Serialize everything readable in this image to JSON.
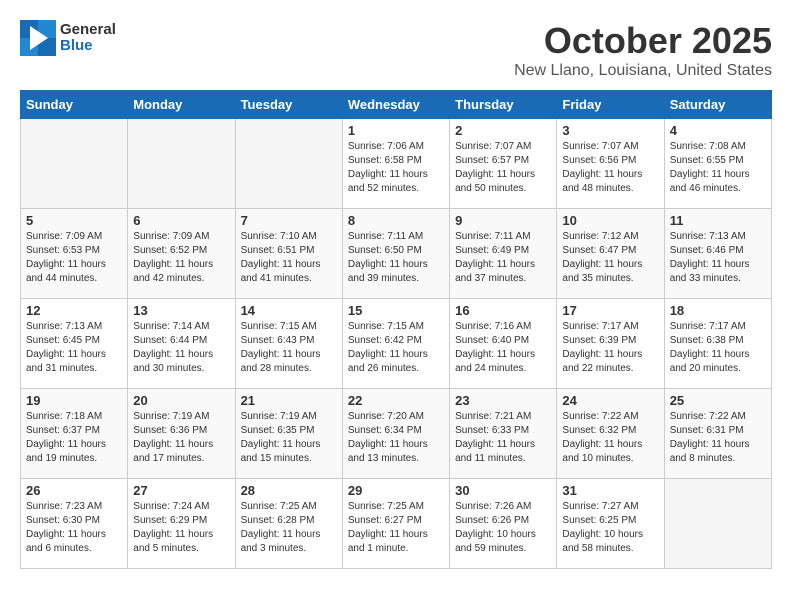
{
  "header": {
    "logo_general": "General",
    "logo_blue": "Blue",
    "month_title": "October 2025",
    "location": "New Llano, Louisiana, United States"
  },
  "weekdays": [
    "Sunday",
    "Monday",
    "Tuesday",
    "Wednesday",
    "Thursday",
    "Friday",
    "Saturday"
  ],
  "weeks": [
    [
      {
        "day": "",
        "empty": true
      },
      {
        "day": "",
        "empty": true
      },
      {
        "day": "",
        "empty": true
      },
      {
        "day": "1",
        "sunrise": "7:06 AM",
        "sunset": "6:58 PM",
        "daylight": "11 hours and 52 minutes."
      },
      {
        "day": "2",
        "sunrise": "7:07 AM",
        "sunset": "6:57 PM",
        "daylight": "11 hours and 50 minutes."
      },
      {
        "day": "3",
        "sunrise": "7:07 AM",
        "sunset": "6:56 PM",
        "daylight": "11 hours and 48 minutes."
      },
      {
        "day": "4",
        "sunrise": "7:08 AM",
        "sunset": "6:55 PM",
        "daylight": "11 hours and 46 minutes."
      }
    ],
    [
      {
        "day": "5",
        "sunrise": "7:09 AM",
        "sunset": "6:53 PM",
        "daylight": "11 hours and 44 minutes."
      },
      {
        "day": "6",
        "sunrise": "7:09 AM",
        "sunset": "6:52 PM",
        "daylight": "11 hours and 42 minutes."
      },
      {
        "day": "7",
        "sunrise": "7:10 AM",
        "sunset": "6:51 PM",
        "daylight": "11 hours and 41 minutes."
      },
      {
        "day": "8",
        "sunrise": "7:11 AM",
        "sunset": "6:50 PM",
        "daylight": "11 hours and 39 minutes."
      },
      {
        "day": "9",
        "sunrise": "7:11 AM",
        "sunset": "6:49 PM",
        "daylight": "11 hours and 37 minutes."
      },
      {
        "day": "10",
        "sunrise": "7:12 AM",
        "sunset": "6:47 PM",
        "daylight": "11 hours and 35 minutes."
      },
      {
        "day": "11",
        "sunrise": "7:13 AM",
        "sunset": "6:46 PM",
        "daylight": "11 hours and 33 minutes."
      }
    ],
    [
      {
        "day": "12",
        "sunrise": "7:13 AM",
        "sunset": "6:45 PM",
        "daylight": "11 hours and 31 minutes."
      },
      {
        "day": "13",
        "sunrise": "7:14 AM",
        "sunset": "6:44 PM",
        "daylight": "11 hours and 30 minutes."
      },
      {
        "day": "14",
        "sunrise": "7:15 AM",
        "sunset": "6:43 PM",
        "daylight": "11 hours and 28 minutes."
      },
      {
        "day": "15",
        "sunrise": "7:15 AM",
        "sunset": "6:42 PM",
        "daylight": "11 hours and 26 minutes."
      },
      {
        "day": "16",
        "sunrise": "7:16 AM",
        "sunset": "6:40 PM",
        "daylight": "11 hours and 24 minutes."
      },
      {
        "day": "17",
        "sunrise": "7:17 AM",
        "sunset": "6:39 PM",
        "daylight": "11 hours and 22 minutes."
      },
      {
        "day": "18",
        "sunrise": "7:17 AM",
        "sunset": "6:38 PM",
        "daylight": "11 hours and 20 minutes."
      }
    ],
    [
      {
        "day": "19",
        "sunrise": "7:18 AM",
        "sunset": "6:37 PM",
        "daylight": "11 hours and 19 minutes."
      },
      {
        "day": "20",
        "sunrise": "7:19 AM",
        "sunset": "6:36 PM",
        "daylight": "11 hours and 17 minutes."
      },
      {
        "day": "21",
        "sunrise": "7:19 AM",
        "sunset": "6:35 PM",
        "daylight": "11 hours and 15 minutes."
      },
      {
        "day": "22",
        "sunrise": "7:20 AM",
        "sunset": "6:34 PM",
        "daylight": "11 hours and 13 minutes."
      },
      {
        "day": "23",
        "sunrise": "7:21 AM",
        "sunset": "6:33 PM",
        "daylight": "11 hours and 11 minutes."
      },
      {
        "day": "24",
        "sunrise": "7:22 AM",
        "sunset": "6:32 PM",
        "daylight": "11 hours and 10 minutes."
      },
      {
        "day": "25",
        "sunrise": "7:22 AM",
        "sunset": "6:31 PM",
        "daylight": "11 hours and 8 minutes."
      }
    ],
    [
      {
        "day": "26",
        "sunrise": "7:23 AM",
        "sunset": "6:30 PM",
        "daylight": "11 hours and 6 minutes."
      },
      {
        "day": "27",
        "sunrise": "7:24 AM",
        "sunset": "6:29 PM",
        "daylight": "11 hours and 5 minutes."
      },
      {
        "day": "28",
        "sunrise": "7:25 AM",
        "sunset": "6:28 PM",
        "daylight": "11 hours and 3 minutes."
      },
      {
        "day": "29",
        "sunrise": "7:25 AM",
        "sunset": "6:27 PM",
        "daylight": "11 hours and 1 minute."
      },
      {
        "day": "30",
        "sunrise": "7:26 AM",
        "sunset": "6:26 PM",
        "daylight": "10 hours and 59 minutes."
      },
      {
        "day": "31",
        "sunrise": "7:27 AM",
        "sunset": "6:25 PM",
        "daylight": "10 hours and 58 minutes."
      },
      {
        "day": "",
        "empty": true
      }
    ]
  ],
  "labels": {
    "sunrise": "Sunrise:",
    "sunset": "Sunset:",
    "daylight": "Daylight:"
  }
}
